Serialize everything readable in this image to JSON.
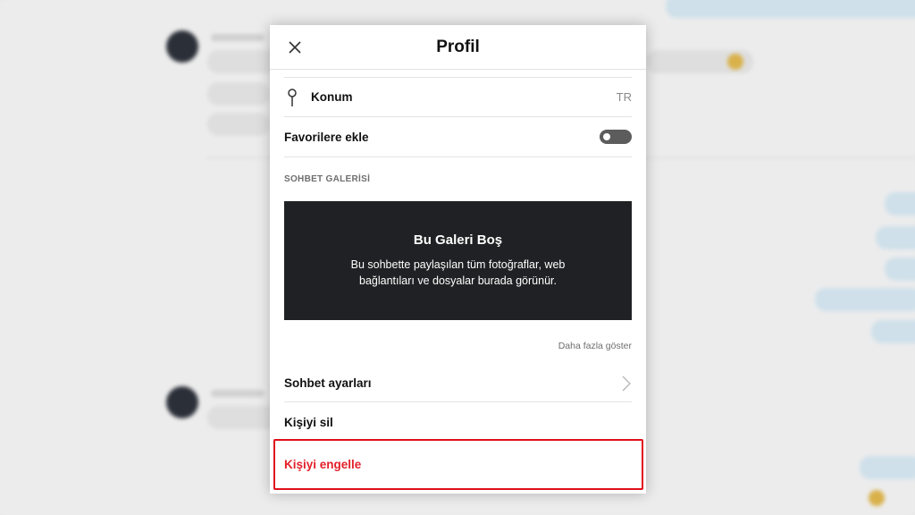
{
  "panel": {
    "title": "Profil",
    "close_icon": "close-icon"
  },
  "location": {
    "label": "Konum",
    "value": "TR",
    "icon": "pin-icon"
  },
  "favorites": {
    "label": "Favorilere ekle",
    "toggle_on": false
  },
  "gallery": {
    "section_label": "SOHBET GALERİSİ",
    "title": "Bu Galeri Boş",
    "description": "Bu sohbette paylaşılan tüm fotoğraflar, web bağlantıları ve dosyalar burada görünür.",
    "more_label": "Daha fazla göster"
  },
  "actions": {
    "chat_settings": "Sohbet ayarları",
    "delete_contact": "Kişiyi sil",
    "block_contact": "Kişiyi engelle"
  },
  "colors": {
    "danger": "#e3202a",
    "highlight_border": "#e0101a",
    "gallery_bg": "#202124"
  }
}
